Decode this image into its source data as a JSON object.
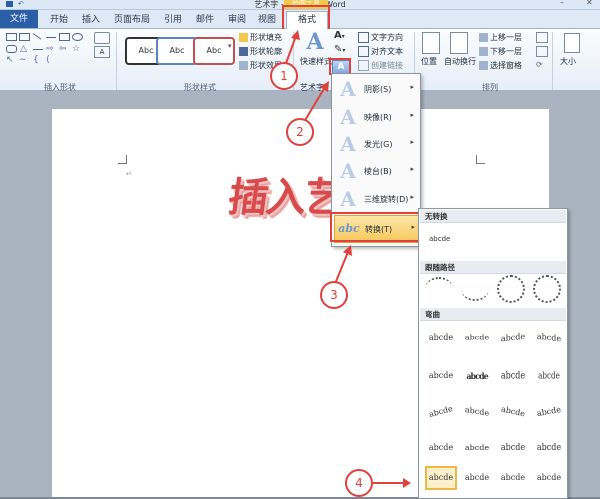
{
  "titlebar": {
    "title": "艺术字 - Microsoft Word",
    "context_label": "绘图工具"
  },
  "tabs": [
    "文件",
    "开始",
    "插入",
    "页面布局",
    "引用",
    "邮件",
    "审阅",
    "视图",
    "格式"
  ],
  "ribbon": {
    "group_insert_shapes": "插入形状",
    "group_shape_styles": "形状样式",
    "group_arrange": "排列",
    "group_size": "大小",
    "style_swatches": [
      "Abc",
      "Abc",
      "Abc"
    ],
    "shape_fill": "形状填充",
    "shape_outline": "形状轮廓",
    "shape_effects": "形状效果",
    "quick_styles": "快速样式",
    "wordart_styles_partial": "艺术字",
    "text_direction": "文字方向",
    "align_text": "对齐文本",
    "create_link": "创建链接",
    "position": "位置",
    "auto_wrap": "自动换行",
    "bring_forward": "上移一层",
    "send_backward": "下移一层",
    "selection_pane": "选择窗格",
    "size": "大小"
  },
  "document": {
    "wordart_text": "插入艺术"
  },
  "menu": {
    "items": [
      {
        "label": "阴影(S)",
        "icon": "text-effect-shadow-icon"
      },
      {
        "label": "映像(R)",
        "icon": "text-effect-reflection-icon"
      },
      {
        "label": "发光(G)",
        "icon": "text-effect-glow-icon"
      },
      {
        "label": "棱台(B)",
        "icon": "text-effect-bevel-icon"
      },
      {
        "label": "三维旋转(D)",
        "icon": "text-effect-3d-rotation-icon"
      },
      {
        "label": "转换(T)",
        "icon": "text-effect-transform-icon"
      }
    ]
  },
  "submenu": {
    "no_transform_title": "无转换",
    "no_transform_sample": "abcde",
    "follow_path_title": "跟随路径",
    "warp_title": "弯曲",
    "warp_rows": [
      [
        "abcde",
        "abcde",
        "abcde",
        "abcde"
      ],
      [
        "abcde",
        "abcde",
        "abcde",
        "abcde"
      ],
      [
        "abcde",
        "abcde",
        "abcde",
        "abcde"
      ],
      [
        "abcde",
        "abcde",
        "abcde",
        "abcde"
      ],
      [
        "abcde",
        "abcde",
        "abcde",
        "abcde"
      ]
    ]
  },
  "annotations": [
    "1",
    "2",
    "3",
    "4"
  ],
  "colors": {
    "accent_red": "#e0413b",
    "file_tab": "#2a5ea6",
    "highlight": "#f7c85a"
  }
}
